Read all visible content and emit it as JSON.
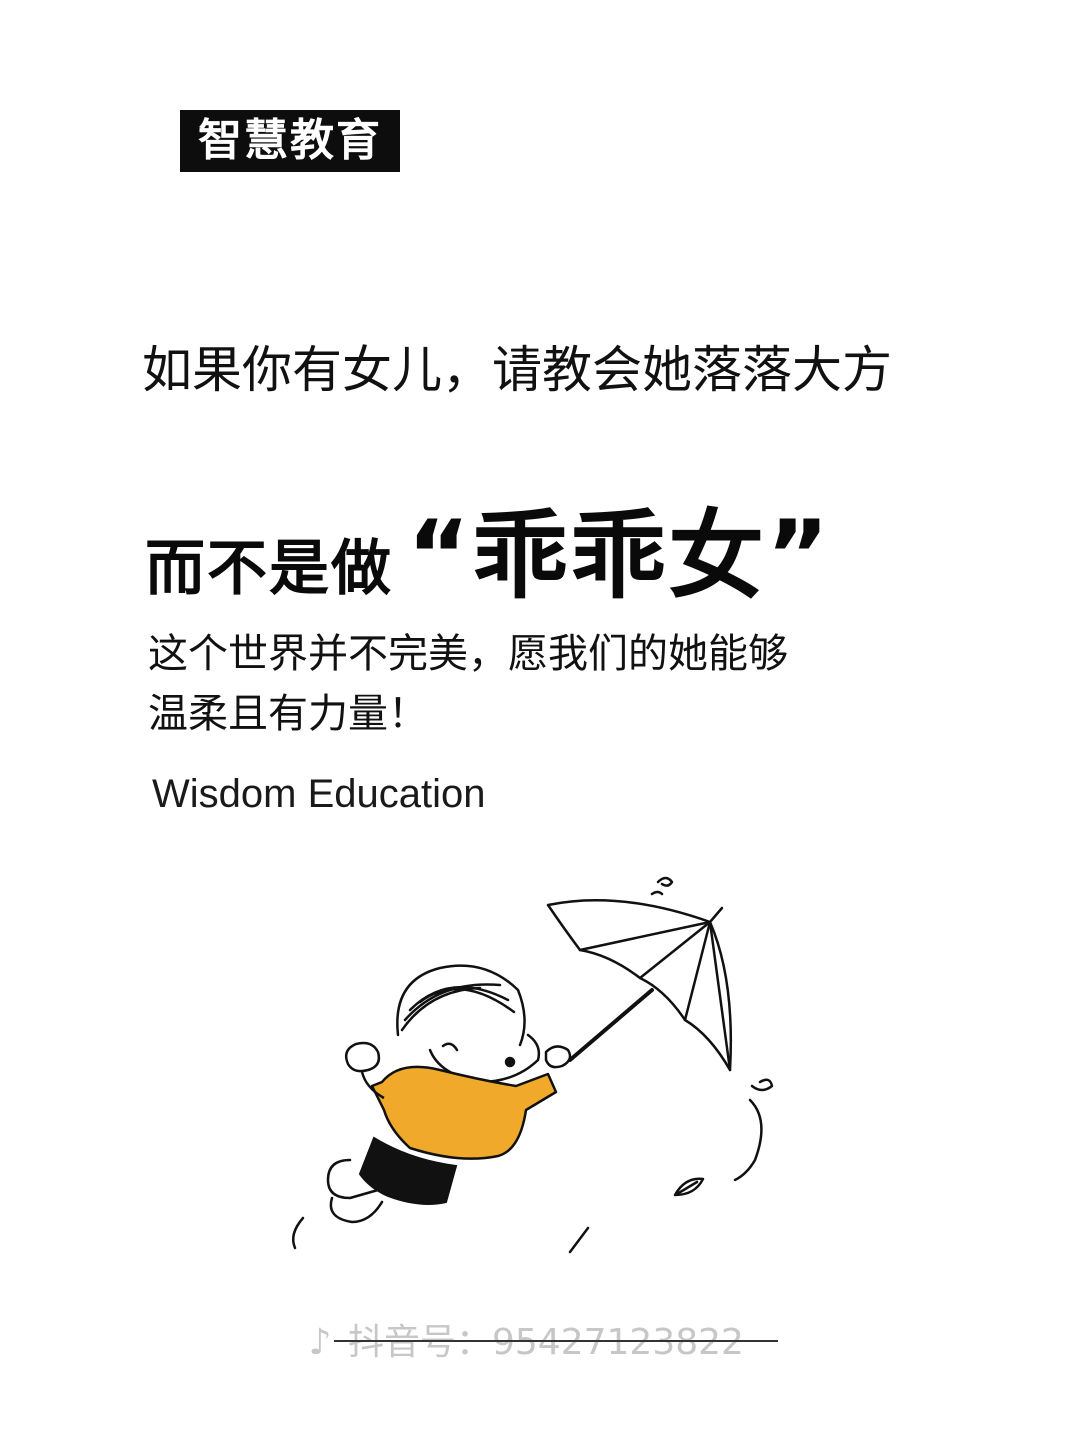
{
  "brand": {
    "tag_label": "智慧教育"
  },
  "headline": {
    "line1": "如果你有女儿，请教会她落落大方",
    "line2_prefix": "而不是做",
    "line2_quote": "“乖乖女”"
  },
  "body": {
    "line1": "这个世界并不完美，愿我们的她能够",
    "line2": "温柔且有力量！"
  },
  "subtitle_en": "Wisdom Education",
  "watermark": {
    "logo_icon": "douyin-logo-icon",
    "text": "抖音号：95427123822"
  },
  "colors": {
    "tag_bg": "#0d0d0d",
    "tag_text": "#ffffff",
    "shirt": "#f0a92a",
    "ink": "#111111"
  }
}
